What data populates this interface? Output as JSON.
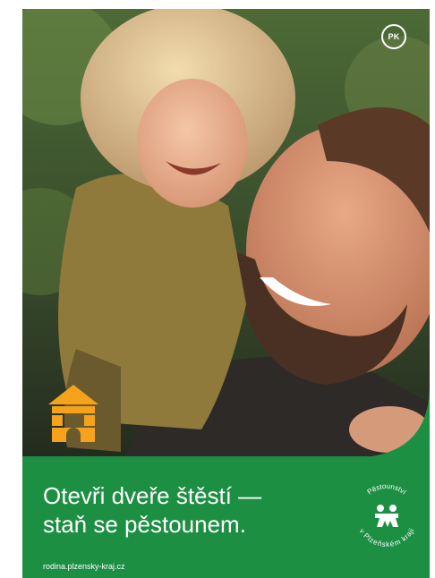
{
  "logo": {
    "text": "PK"
  },
  "headline": {
    "line1": "Otevři dveře štěstí —",
    "line2": "staň se pěstounem."
  },
  "website": "rodina.plzensky-kraj.cz",
  "badge": {
    "top_text": "Pěstounství",
    "bottom_text": "v Plzeňském kraji"
  },
  "colors": {
    "brand_green": "#1d8f43",
    "house_orange": "#f6a31b",
    "white": "#ffffff"
  },
  "icons": {
    "house": "house-icon",
    "badge_figures": "foster-family-icon"
  }
}
